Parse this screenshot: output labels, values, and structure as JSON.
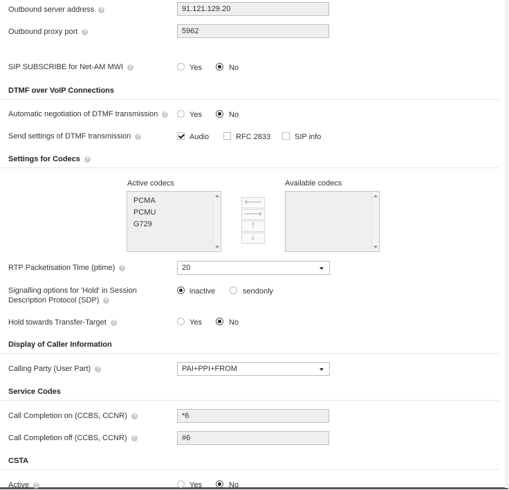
{
  "help_glyph": "?",
  "colors": {
    "field_bg": "#efefef",
    "border": "#bdbdbd",
    "text": "#333333"
  },
  "outbound_server": {
    "label": "Outbound server address",
    "value": "91.121.129.20"
  },
  "outbound_proxy": {
    "label": "Outbound proxy port",
    "value": "5962"
  },
  "sip_subscribe": {
    "label": "SIP SUBSCRIBE for Net-AM MWI",
    "yes": "Yes",
    "no": "No",
    "selected": "No"
  },
  "dtmf": {
    "heading": "DTMF over VoIP Connections",
    "auto_label": "Automatic negotiation of DTMF transmission",
    "auto_yes": "Yes",
    "auto_no": "No",
    "auto_selected": "No",
    "send_label": "Send settings of DTMF transmission",
    "options": [
      {
        "label": "Audio",
        "checked": true
      },
      {
        "label": "RFC 2833",
        "checked": false
      },
      {
        "label": "SIP info",
        "checked": false
      }
    ]
  },
  "codecs": {
    "heading": "Settings for Codecs",
    "active_title": "Active codecs",
    "available_title": "Available codecs",
    "active": [
      "PCMA",
      "PCMU",
      "G729"
    ],
    "available": [],
    "buttons": {
      "left": "🡐",
      "right": "🡒",
      "up": "🡑",
      "down": "🡓"
    }
  },
  "rtp": {
    "label": "RTP Packetisation Time (ptime)",
    "value": "20"
  },
  "hold_sdp": {
    "label_line1": "Signalling options for 'Hold' in Session",
    "label_line2": "Description Protocol (SDP)",
    "opt1": "inactive",
    "opt2": "sendonly",
    "selected": "inactive"
  },
  "hold_transfer": {
    "label": "Hold towards Transfer-Target",
    "yes": "Yes",
    "no": "No",
    "selected": "No"
  },
  "caller_info": {
    "heading": "Display of Caller Information",
    "label": "Calling Party (User Part)",
    "value": "PAI+PPI+FROM"
  },
  "service_codes": {
    "heading": "Service Codes",
    "ccbs_on_label": "Call Completion on (CCBS, CCNR)",
    "ccbs_on_value": "*6",
    "ccbs_off_label": "Call Completion off (CCBS, CCNR)",
    "ccbs_off_value": "#6"
  },
  "csta": {
    "heading": "CSTA",
    "active_label": "Active",
    "yes": "Yes",
    "no": "No",
    "selected": "No"
  }
}
